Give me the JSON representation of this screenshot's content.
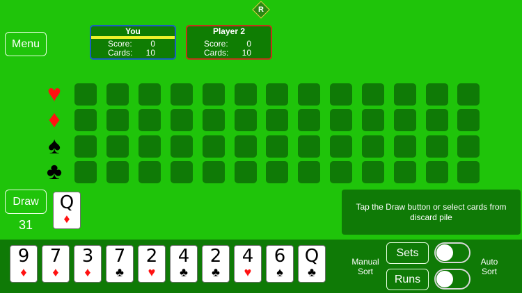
{
  "logo": {
    "letter": "R"
  },
  "menu_button": {
    "label": "Menu"
  },
  "players": [
    {
      "name": "You",
      "score_label": "Score:",
      "score": "0",
      "cards_label": "Cards:",
      "cards": "10",
      "active": true
    },
    {
      "name": "Player 2",
      "score_label": "Score:",
      "score": "0",
      "cards_label": "Cards:",
      "cards": "10",
      "active": false
    }
  ],
  "meld_rows": [
    {
      "suit": "hearts",
      "glyph": "♥",
      "color": "#ff1111"
    },
    {
      "suit": "diamonds",
      "glyph": "♦",
      "color": "#ff1111"
    },
    {
      "suit": "spades",
      "glyph": "♠",
      "color": "#000000"
    },
    {
      "suit": "clubs",
      "glyph": "♣",
      "color": "#000000"
    }
  ],
  "draw": {
    "label": "Draw",
    "count": "31"
  },
  "discard_top": {
    "rank": "Q",
    "suit": "♦",
    "color": "red"
  },
  "message": "Tap the Draw button or select cards from discard pile",
  "hand": [
    {
      "rank": "9",
      "suit": "♦",
      "color": "red"
    },
    {
      "rank": "7",
      "suit": "♦",
      "color": "red"
    },
    {
      "rank": "3",
      "suit": "♦",
      "color": "red"
    },
    {
      "rank": "7",
      "suit": "♣",
      "color": "blk"
    },
    {
      "rank": "2",
      "suit": "♥",
      "color": "red"
    },
    {
      "rank": "4",
      "suit": "♣",
      "color": "blk"
    },
    {
      "rank": "2",
      "suit": "♣",
      "color": "blk"
    },
    {
      "rank": "4",
      "suit": "♥",
      "color": "red"
    },
    {
      "rank": "6",
      "suit": "♠",
      "color": "blk"
    },
    {
      "rank": "Q",
      "suit": "♣",
      "color": "blk"
    }
  ],
  "sort": {
    "manual_line1": "Manual",
    "manual_line2": "Sort",
    "sets_label": "Sets",
    "runs_label": "Runs",
    "auto_line1": "Auto",
    "auto_line2": "Sort"
  },
  "colors": {
    "felt": "#1fc40a",
    "panel": "#0f7a06",
    "you_border": "#1a5fc2",
    "p2_border": "#c2341a",
    "active_bar": "#ecf22a"
  }
}
